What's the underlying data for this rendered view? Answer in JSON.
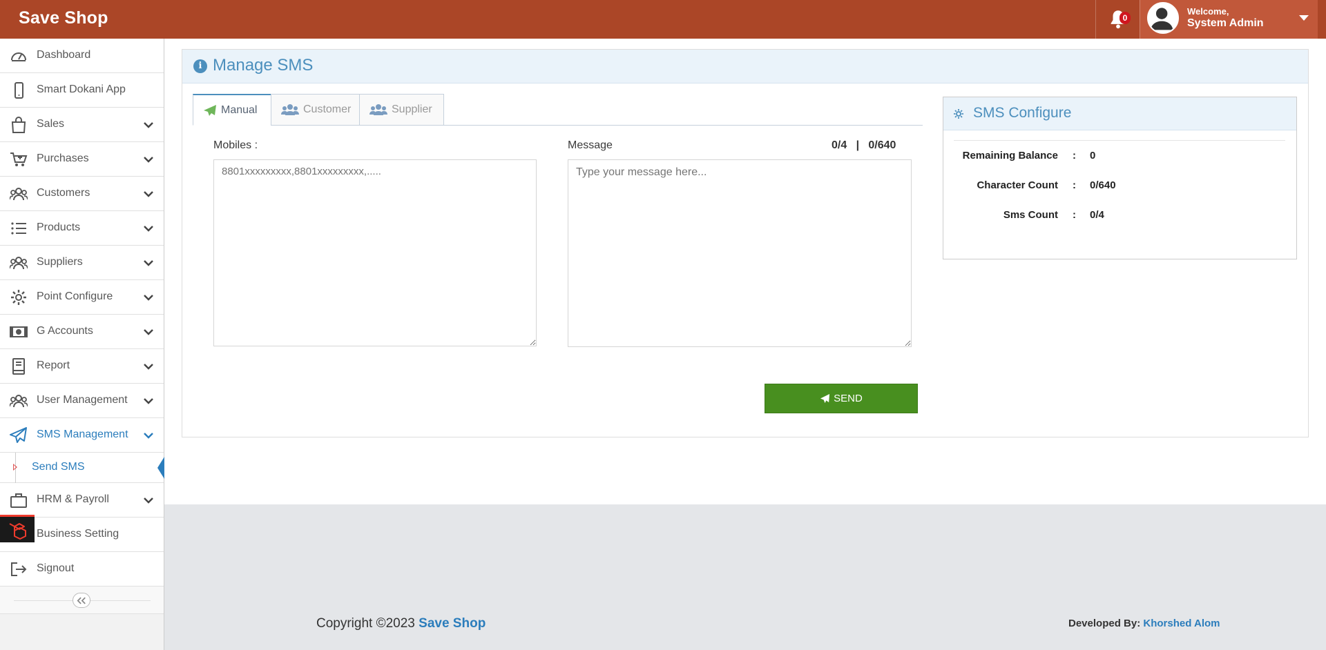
{
  "app": {
    "brand": "Save Shop"
  },
  "header": {
    "notification_count": "0",
    "welcome": "Welcome,",
    "user_name": "System Admin"
  },
  "sidebar": {
    "items": [
      {
        "label": "Dashboard",
        "icon": "speedometer-icon",
        "expandable": false
      },
      {
        "label": "Smart Dokani App",
        "icon": "mobile-icon",
        "expandable": false
      },
      {
        "label": "Sales",
        "icon": "shopping-bag-icon",
        "expandable": true
      },
      {
        "label": "Purchases",
        "icon": "cart-plus-icon",
        "expandable": true
      },
      {
        "label": "Customers",
        "icon": "users-icon",
        "expandable": true
      },
      {
        "label": "Products",
        "icon": "list-icon",
        "expandable": true
      },
      {
        "label": "Suppliers",
        "icon": "users-icon",
        "expandable": true
      },
      {
        "label": "Point Configure",
        "icon": "gear-icon",
        "expandable": true
      },
      {
        "label": "G Accounts",
        "icon": "money-icon",
        "expandable": true
      },
      {
        "label": "Report",
        "icon": "book-icon",
        "expandable": true
      },
      {
        "label": "User Management",
        "icon": "users-icon",
        "expandable": true
      },
      {
        "label": "SMS Management",
        "icon": "paper-plane-icon",
        "expandable": true,
        "active": true
      },
      {
        "label": "HRM & Payroll",
        "icon": "briefcase-icon",
        "expandable": true
      },
      {
        "label": "Business Setting",
        "icon": "gears-icon",
        "expandable": false
      },
      {
        "label": "Signout",
        "icon": "sign-out-icon",
        "expandable": false
      }
    ],
    "submenu": {
      "label": "Send SMS"
    }
  },
  "main": {
    "title": "Manage SMS",
    "tabs": [
      {
        "label": "Manual",
        "active": true
      },
      {
        "label": "Customer",
        "active": false
      },
      {
        "label": "Supplier",
        "active": false
      }
    ],
    "mobiles_label": "Mobiles :",
    "mobiles_placeholder": "8801xxxxxxxxx,8801xxxxxxxxx,.....",
    "message_label": "Message",
    "counter": "0/4   |   0/640",
    "message_placeholder": "Type your message here...",
    "send_label": "SEND"
  },
  "sms_configure": {
    "title": "SMS Configure",
    "rows": [
      {
        "key": "Remaining Balance",
        "value": "0"
      },
      {
        "key": "Character Count",
        "value": "0/640"
      },
      {
        "key": "Sms Count",
        "value": "0/4"
      }
    ]
  },
  "footer": {
    "copyright": "Copyright ©2023",
    "brand": "Save Shop",
    "developed_by": "Developed By:",
    "developer": "Khorshed Alom"
  },
  "colors": {
    "navbar": "#ab4627",
    "accent_blue": "#4c8fbd",
    "send_green": "#488f1f"
  }
}
